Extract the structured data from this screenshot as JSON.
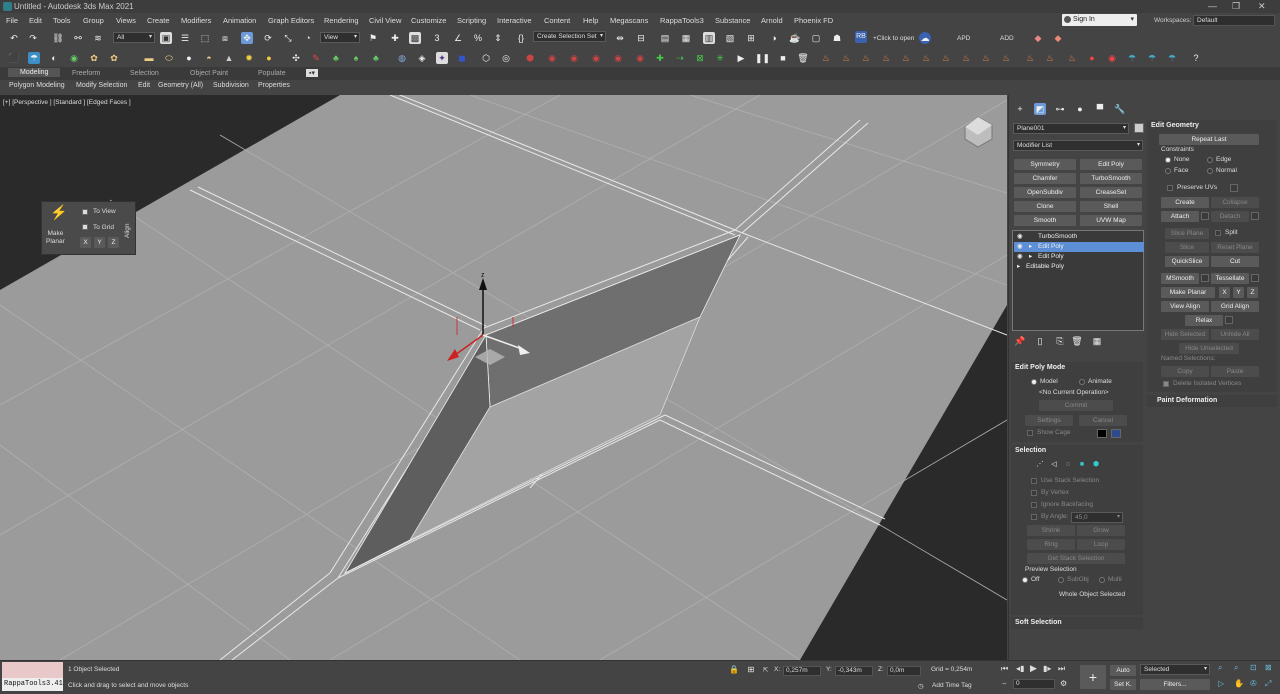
{
  "window": {
    "title": "Untitled - Autodesk 3ds Max 2021",
    "controls": [
      "—",
      "❐",
      "✕"
    ]
  },
  "menu": [
    "File",
    "Edit",
    "Tools",
    "Group",
    "Views",
    "Create",
    "Modifiers",
    "Animation",
    "Graph Editors",
    "Rendering",
    "Civil View",
    "Customize",
    "Scripting",
    "Interactive",
    "Content",
    "Help",
    "Megascans",
    "RappaTools3",
    "Substance",
    "Arnold",
    "Phoenix FD"
  ],
  "account": {
    "sign_in": "Sign In",
    "workspaces_label": "Workspaces:",
    "workspace": "Default"
  },
  "toolbar": {
    "filter": "All",
    "ref_coord": "View",
    "selection_set": "Create Selection Set",
    "click_to_open": "+Click to open",
    "apd": "APD",
    "add": "ADD",
    "rb": "RB"
  },
  "ribbon": {
    "tabs": [
      "Modeling",
      "Freeform",
      "Selection",
      "Object Paint",
      "Populate"
    ],
    "sub": [
      "Polygon Modeling",
      "Modify Selection",
      "Edit",
      "Geometry (All)",
      "Subdivision",
      "Properties"
    ]
  },
  "viewport": {
    "label": "[+] [Perspective ] [Standard ] [Edged Faces ]",
    "gizmo_z": "z"
  },
  "align_panel": {
    "make_planar": "Make\nPlanar",
    "to_view": "To View",
    "to_grid": "To Grid",
    "x": "X",
    "y": "Y",
    "z": "Z",
    "align": "Align"
  },
  "command_panel": {
    "object_name": "Plane001",
    "modifier_list": "Modifier List",
    "mod_buttons": [
      "Symmetry",
      "Edit Poly",
      "Chamfer",
      "TurboSmooth",
      "OpenSubdiv",
      "CreaseSet",
      "Clone",
      "Shell",
      "Smooth",
      "UVW Map"
    ],
    "stack": [
      "TurboSmooth",
      "Edit Poly",
      "Edit Poly",
      "Editable Poly"
    ],
    "edit_poly_mode": {
      "title": "Edit Poly Mode",
      "model": "Model",
      "animate": "Animate",
      "no_op": "<No Current Operation>",
      "commit": "Commit",
      "settings": "Settings",
      "cancel": "Cancel",
      "show_cage": "Show Cage"
    },
    "selection": {
      "title": "Selection",
      "use_stack": "Use Stack Selection",
      "by_vertex": "By Vertex",
      "ignore_backfacing": "Ignore Backfacing",
      "by_angle": "By Angle:",
      "angle": "45,0",
      "shrink": "Shrink",
      "grow": "Grow",
      "ring": "Ring",
      "loop": "Loop",
      "get_stack": "Get Stack Selection",
      "preview": "Preview Selection",
      "off": "Off",
      "subobj": "SubObj",
      "multi": "Multi",
      "whole": "Whole Object Selected"
    },
    "soft_selection": "Soft Selection"
  },
  "edit_geometry": {
    "title": "Edit Geometry",
    "repeat_last": "Repeat Last",
    "constraints": "Constraints",
    "none": "None",
    "edge": "Edge",
    "face": "Face",
    "normal": "Normal",
    "preserve_uvs": "Preserve UVs",
    "create": "Create",
    "collapse": "Collapse",
    "attach": "Attach",
    "detach": "Detach",
    "slice_plane": "Slice Plane",
    "split": "Split",
    "slice": "Slice",
    "reset_plane": "Reset Plane",
    "quickslice": "QuickSlice",
    "cut": "Cut",
    "msmooth": "MSmooth",
    "tessellate": "Tessellate",
    "make_planar": "Make Planar",
    "x": "X",
    "y": "Y",
    "z": "Z",
    "view_align": "View Align",
    "grid_align": "Grid Align",
    "relax": "Relax",
    "hide_selected": "Hide Selected",
    "unhide_all": "Unhide All",
    "hide_unselected": "Hide Unselected",
    "named_selections": "Named Selections:",
    "copy": "Copy",
    "paste": "Paste",
    "delete_isolated": "Delete Isolated Vertices",
    "paint_deformation": "Paint Deformation"
  },
  "status": {
    "maxscript": "RappaTools3.41",
    "selected": "1 Object Selected",
    "hint": "Click and drag to select and move objects",
    "x_label": "X:",
    "x": "0,257m",
    "y_label": "Y:",
    "y": "-0,343m",
    "z_label": "Z:",
    "z": "0,0m",
    "grid": "Grid = 0,254m",
    "add_time_tag": "Add Time Tag",
    "frame": "0",
    "auto": "Auto",
    "set_k": "Set K.",
    "selected_set": "Selected",
    "filters": "Filters..."
  }
}
